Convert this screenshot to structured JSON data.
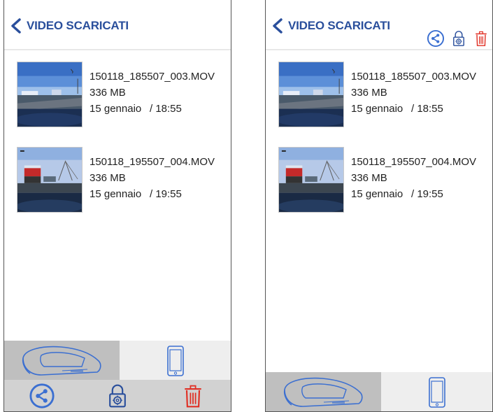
{
  "screens": [
    {
      "header": {
        "back_label": "VIDEO SCARICATI"
      },
      "videos": [
        {
          "filename": "150118_185507_003.MOV",
          "size": "336 MB",
          "date": "15 gennaio",
          "time": "/ 18:55"
        },
        {
          "filename": "150118_195507_004.MOV",
          "size": "336 MB",
          "date": "15 gennaio",
          "time": "/ 19:55"
        }
      ],
      "tabs": {
        "camera": "dashcam-icon",
        "phone": "phone-icon",
        "selected": "camera"
      },
      "actions": [
        "share-icon",
        "lock-settings-icon",
        "trash-icon"
      ]
    },
    {
      "header": {
        "back_label": "VIDEO SCARICATI"
      },
      "header_actions": [
        "share-icon",
        "lock-settings-icon",
        "trash-icon"
      ],
      "videos": [
        {
          "filename": "150118_185507_003.MOV",
          "size": "336 MB",
          "date": "15 gennaio",
          "time": "/ 18:55"
        },
        {
          "filename": "150118_195507_004.MOV",
          "size": "336 MB",
          "date": "15 gennaio",
          "time": "/ 19:55"
        }
      ],
      "tabs": {
        "camera": "dashcam-icon",
        "phone": "phone-icon",
        "selected": "camera"
      }
    }
  ],
  "colors": {
    "accent": "#2a4f9c",
    "share": "#3b6fd1",
    "trash": "#e03025",
    "tab_selected": "#bfbfbf",
    "tab_other": "#eeeeee",
    "action_bar": "#d2d2d2"
  }
}
